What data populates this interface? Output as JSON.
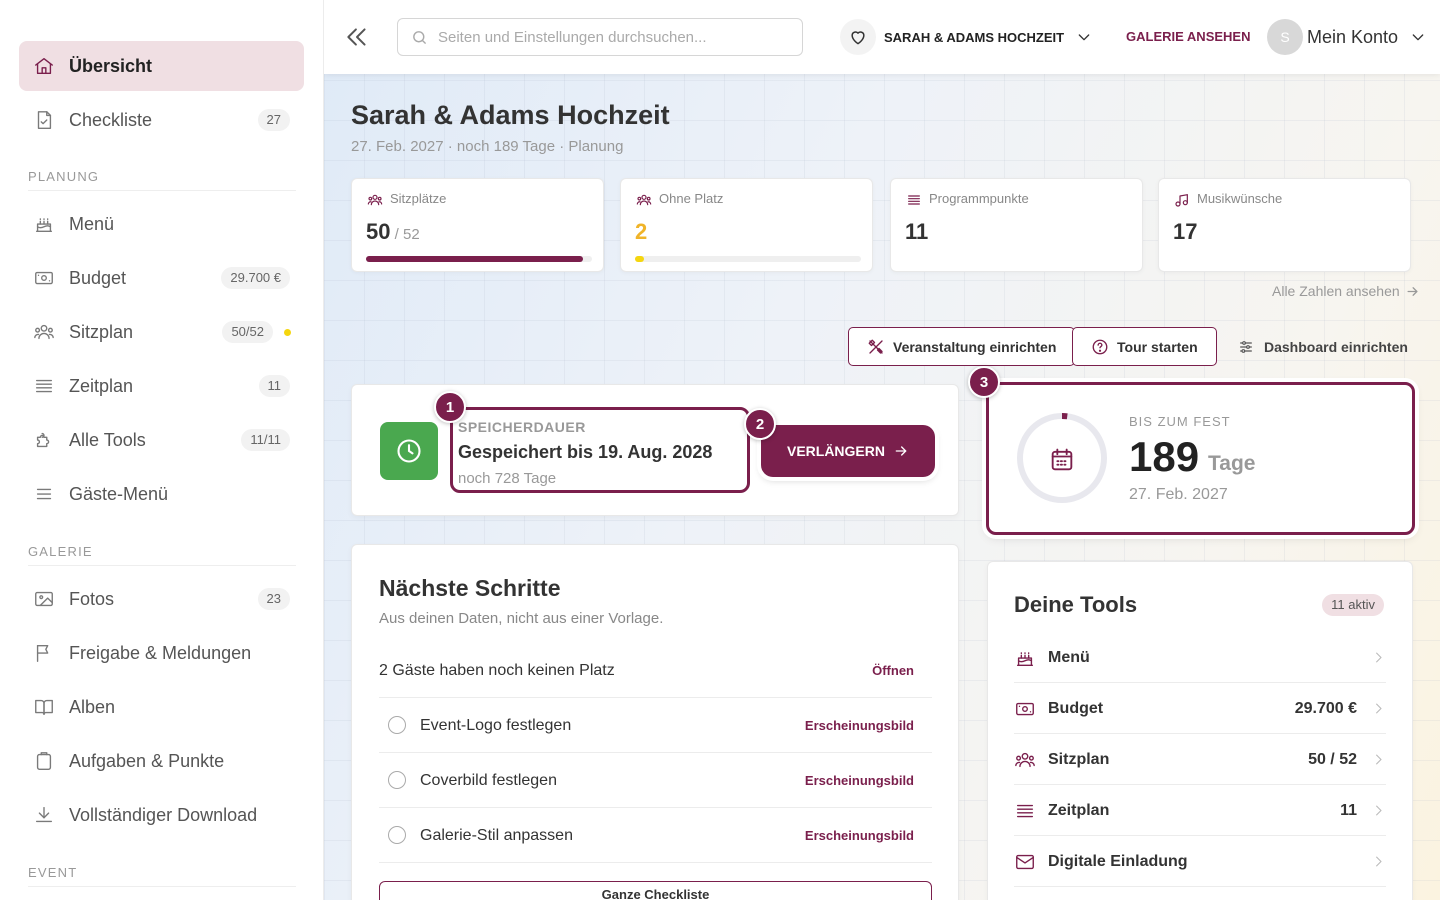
{
  "sidebar": {
    "items": [
      {
        "label": "Übersicht",
        "icon": "home-icon",
        "active": true
      },
      {
        "label": "Checkliste",
        "icon": "checklist-icon",
        "badge": "27"
      }
    ],
    "sections": [
      {
        "title": "PLANUNG",
        "items": [
          {
            "label": "Menü",
            "icon": "cake-icon"
          },
          {
            "label": "Budget",
            "icon": "money-icon",
            "badge": "29.700 €"
          },
          {
            "label": "Sitzplan",
            "icon": "users-icon",
            "badge": "50/52",
            "dot_color": "#f5d60f"
          },
          {
            "label": "Zeitplan",
            "icon": "list-icon",
            "badge": "11"
          },
          {
            "label": "Alle Tools",
            "icon": "puzzle-icon",
            "badge": "11/11"
          },
          {
            "label": "Gäste-Menü",
            "icon": "menu-icon"
          }
        ]
      },
      {
        "title": "GALERIE",
        "items": [
          {
            "label": "Fotos",
            "icon": "image-icon",
            "badge": "23"
          },
          {
            "label": "Freigabe & Meldungen",
            "icon": "flag-icon"
          },
          {
            "label": "Alben",
            "icon": "book-icon"
          },
          {
            "label": "Aufgaben & Punkte",
            "icon": "clipboard-icon"
          },
          {
            "label": "Vollständiger Download",
            "icon": "download-icon"
          }
        ]
      },
      {
        "title": "EVENT",
        "items": []
      }
    ]
  },
  "topbar": {
    "search_placeholder": "Seiten und Einstellungen durchsuchen...",
    "event_name": "SARAH & ADAMS HOCHZEIT",
    "gallery_link": "GALERIE ANSEHEN",
    "avatar_initial": "S",
    "account_label": "Mein Konto"
  },
  "header": {
    "title": "Sarah & Adams Hochzeit",
    "subtitle": "27. Feb. 2027 · noch 189 Tage · Planung"
  },
  "stats": [
    {
      "label": "Sitzplätze",
      "icon": "users-icon",
      "value": "50",
      "suffix": " / 52",
      "progress": 0.96,
      "color": "#7a1f4c"
    },
    {
      "label": "Ohne Platz",
      "icon": "users-icon",
      "value": "2",
      "progress": 0.04,
      "color": "#f5d60f",
      "value_color": "#f0b429"
    },
    {
      "label": "Programmpunkte",
      "icon": "list-icon",
      "value": "11"
    },
    {
      "label": "Musikwünsche",
      "icon": "music-icon",
      "value": "17"
    }
  ],
  "all_stats_link": "Alle Zahlen ansehen",
  "actions": {
    "setup": "Veranstaltung einrichten",
    "tour": "Tour starten",
    "dashboard": "Dashboard einrichten"
  },
  "storage": {
    "kicker": "SPEICHERDAUER",
    "main": "Gespeichert bis 19. Aug. 2028",
    "rest": "noch 728 Tage",
    "extend": "VERLÄNGERN"
  },
  "tour_steps": [
    "1",
    "2",
    "3"
  ],
  "countdown": {
    "kicker": "BIS ZUM FEST",
    "number": "189",
    "unit": "Tage",
    "date": "27. Feb. 2027",
    "progress": 0.02
  },
  "next_steps": {
    "title": "Nächste Schritte",
    "subtitle": "Aus deinen Daten, nicht aus einer Vorlage.",
    "rows": [
      {
        "label": "2 Gäste haben noch keinen Platz",
        "action": "Öffnen",
        "checkbox": false
      },
      {
        "label": "Event-Logo festlegen",
        "action": "Erscheinungsbild",
        "checkbox": true
      },
      {
        "label": "Coverbild festlegen",
        "action": "Erscheinungsbild",
        "checkbox": true
      },
      {
        "label": "Galerie-Stil anpassen",
        "action": "Erscheinungsbild",
        "checkbox": true
      }
    ],
    "button": "Ganze Checkliste"
  },
  "tools": {
    "title": "Deine Tools",
    "badge": "11 aktiv",
    "items": [
      {
        "label": "Menü",
        "icon": "cake-icon",
        "value": ""
      },
      {
        "label": "Budget",
        "icon": "money-icon",
        "value": "29.700 €"
      },
      {
        "label": "Sitzplan",
        "icon": "users-icon",
        "value": "50 / 52"
      },
      {
        "label": "Zeitplan",
        "icon": "list-icon",
        "value": "11"
      },
      {
        "label": "Digitale Einladung",
        "icon": "mail-icon",
        "value": ""
      }
    ]
  },
  "colors": {
    "accent": "#7a1f4c",
    "accent_light": "#f0dfe3",
    "success": "#4aa84f",
    "warning": "#f5d60f"
  }
}
